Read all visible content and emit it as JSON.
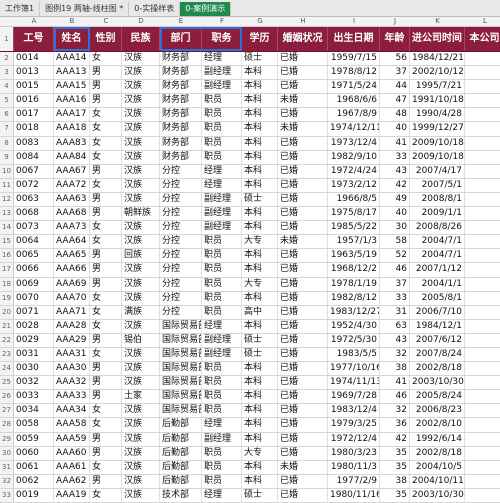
{
  "tabs": [
    {
      "label": "工作簿1",
      "state": "normal"
    },
    {
      "label": "图例19  两轴-线柱图 *",
      "state": "normal"
    },
    {
      "label": "0-实操样表",
      "state": "normal"
    },
    {
      "label": "0-案例演示",
      "state": "active"
    }
  ],
  "column_letters": [
    "A",
    "B",
    "C",
    "D",
    "E",
    "F",
    "G",
    "H",
    "I",
    "J",
    "K",
    "L"
  ],
  "headers": [
    "工号",
    "姓名",
    "性别",
    "民族",
    "部门",
    "职务",
    "学历",
    "婚姻状况",
    "出生日期",
    "年龄",
    "进公司时间",
    "本公司"
  ],
  "rows": [
    [
      "0014",
      "AAA14",
      "女",
      "汉族",
      "财务部",
      "经理",
      "硕士",
      "已婚",
      "1959/7/15",
      "56",
      "1984/12/21"
    ],
    [
      "0013",
      "AAA13",
      "男",
      "汉族",
      "财务部",
      "副经理",
      "本科",
      "已婚",
      "1978/8/12",
      "37",
      "2002/10/12"
    ],
    [
      "0015",
      "AAA15",
      "男",
      "汉族",
      "财务部",
      "副经理",
      "本科",
      "已婚",
      "1971/5/24",
      "44",
      "1995/7/21"
    ],
    [
      "0016",
      "AAA16",
      "男",
      "汉族",
      "财务部",
      "职员",
      "本科",
      "未婚",
      "1968/6/6",
      "47",
      "1991/10/18"
    ],
    [
      "0017",
      "AAA17",
      "女",
      "汉族",
      "财务部",
      "职员",
      "本科",
      "已婚",
      "1967/8/9",
      "48",
      "1990/4/28"
    ],
    [
      "0018",
      "AAA18",
      "女",
      "汉族",
      "财务部",
      "职员",
      "本科",
      "未婚",
      "1974/12/11",
      "40",
      "1999/12/27"
    ],
    [
      "0083",
      "AAA83",
      "女",
      "汉族",
      "财务部",
      "职员",
      "本科",
      "已婚",
      "1973/12/4",
      "41",
      "2009/10/18"
    ],
    [
      "0084",
      "AAA84",
      "女",
      "汉族",
      "财务部",
      "职员",
      "本科",
      "已婚",
      "1982/9/10",
      "33",
      "2009/10/18"
    ],
    [
      "0067",
      "AAA67",
      "男",
      "汉族",
      "分控",
      "经理",
      "本科",
      "已婚",
      "1972/4/24",
      "43",
      "2007/4/17"
    ],
    [
      "0072",
      "AAA72",
      "女",
      "汉族",
      "分控",
      "经理",
      "本科",
      "已婚",
      "1973/2/12",
      "42",
      "2007/5/1"
    ],
    [
      "0063",
      "AAA63",
      "男",
      "汉族",
      "分控",
      "副经理",
      "硕士",
      "已婚",
      "1966/8/5",
      "49",
      "2008/8/1"
    ],
    [
      "0068",
      "AAA68",
      "男",
      "朝鲜族",
      "分控",
      "副经理",
      "本科",
      "已婚",
      "1975/8/17",
      "40",
      "2009/1/1"
    ],
    [
      "0073",
      "AAA73",
      "女",
      "汉族",
      "分控",
      "副经理",
      "本科",
      "已婚",
      "1985/5/22",
      "30",
      "2008/8/26"
    ],
    [
      "0064",
      "AAA64",
      "女",
      "汉族",
      "分控",
      "职员",
      "大专",
      "未婚",
      "1957/1/3",
      "58",
      "2004/7/1"
    ],
    [
      "0065",
      "AAA65",
      "男",
      "回族",
      "分控",
      "职员",
      "本科",
      "已婚",
      "1963/5/19",
      "52",
      "2004/7/1"
    ],
    [
      "0066",
      "AAA66",
      "男",
      "汉族",
      "分控",
      "职员",
      "本科",
      "已婚",
      "1968/12/2",
      "46",
      "2007/1/12"
    ],
    [
      "0069",
      "AAA69",
      "男",
      "汉族",
      "分控",
      "职员",
      "大专",
      "已婚",
      "1978/1/19",
      "37",
      "2004/1/1"
    ],
    [
      "0070",
      "AAA70",
      "女",
      "汉族",
      "分控",
      "职员",
      "本科",
      "已婚",
      "1982/8/12",
      "33",
      "2005/8/1"
    ],
    [
      "0071",
      "AAA71",
      "女",
      "满族",
      "分控",
      "职员",
      "高中",
      "已婚",
      "1983/12/27",
      "31",
      "2006/7/10"
    ],
    [
      "0028",
      "AAA28",
      "女",
      "汉族",
      "国际贸易部",
      "经理",
      "本科",
      "已婚",
      "1952/4/30",
      "63",
      "1984/12/1"
    ],
    [
      "0029",
      "AAA29",
      "男",
      "锡伯",
      "国际贸易部",
      "副经理",
      "硕士",
      "已婚",
      "1972/5/30",
      "43",
      "2007/6/12"
    ],
    [
      "0031",
      "AAA31",
      "女",
      "汉族",
      "国际贸易部",
      "副经理",
      "硕士",
      "已婚",
      "1983/5/5",
      "32",
      "2007/8/24"
    ],
    [
      "0030",
      "AAA30",
      "男",
      "汉族",
      "国际贸易部",
      "职员",
      "本科",
      "已婚",
      "1977/10/16",
      "38",
      "2002/8/18"
    ],
    [
      "0032",
      "AAA32",
      "男",
      "汉族",
      "国际贸易部",
      "职员",
      "本科",
      "已婚",
      "1974/11/13",
      "41",
      "2003/10/30"
    ],
    [
      "0033",
      "AAA33",
      "男",
      "土家",
      "国际贸易部",
      "职员",
      "本科",
      "已婚",
      "1969/7/28",
      "46",
      "2005/8/24"
    ],
    [
      "0034",
      "AAA34",
      "女",
      "汉族",
      "国际贸易部",
      "职员",
      "本科",
      "已婚",
      "1983/12/4",
      "32",
      "2006/8/23"
    ],
    [
      "0058",
      "AAA58",
      "女",
      "汉族",
      "后勤部",
      "经理",
      "本科",
      "已婚",
      "1979/3/25",
      "36",
      "2002/8/10"
    ],
    [
      "0059",
      "AAA59",
      "男",
      "汉族",
      "后勤部",
      "副经理",
      "本科",
      "已婚",
      "1972/12/4",
      "42",
      "1992/6/14"
    ],
    [
      "0060",
      "AAA60",
      "男",
      "汉族",
      "后勤部",
      "职员",
      "大专",
      "已婚",
      "1980/3/23",
      "35",
      "2002/8/18"
    ],
    [
      "0061",
      "AAA61",
      "女",
      "汉族",
      "后勤部",
      "职员",
      "本科",
      "未婚",
      "1980/11/3",
      "35",
      "2004/10/5"
    ],
    [
      "0062",
      "AAA62",
      "男",
      "汉族",
      "后勤部",
      "职员",
      "本科",
      "已婚",
      "1977/2/9",
      "38",
      "2004/10/11"
    ],
    [
      "0019",
      "AAA19",
      "女",
      "汉族",
      "技术部",
      "经理",
      "硕士",
      "已婚",
      "1980/11/16",
      "35",
      "2003/10/30"
    ]
  ]
}
